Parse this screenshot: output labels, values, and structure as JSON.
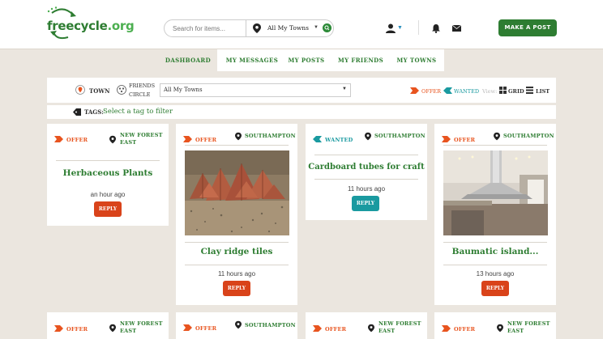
{
  "header": {
    "logo_text": "freecycle",
    "logo_suffix": ".org",
    "search_placeholder": "Search for items...",
    "town_select": "All My Towns",
    "make_post": "MAKE A POST"
  },
  "nav": {
    "tabs": [
      {
        "label": "DASHBOARD",
        "active": true
      },
      {
        "label": "MY MESSAGES",
        "active": false
      },
      {
        "label": "MY POSTS",
        "active": false
      },
      {
        "label": "MY FRIENDS",
        "active": false
      },
      {
        "label": "MY TOWNS",
        "active": false
      }
    ]
  },
  "filters": {
    "town_label": "TOWN",
    "circle_label_1": "FRIENDS",
    "circle_label_2": "CIRCLE",
    "town_dropdown": "All My Towns",
    "offer_label": "OFFER",
    "wanted_label": "WANTED",
    "view_label": "View:",
    "grid_label": "GRID",
    "list_label": "LIST",
    "tags_label": "TAGS:",
    "tags_placeholder": "Select a tag to filter"
  },
  "colors": {
    "brand_green": "#2e7d32",
    "offer_orange": "#e8541f",
    "wanted_teal": "#1a9aa0",
    "reply_red": "#d9431a"
  },
  "cards": [
    {
      "type": "OFFER",
      "location_1": "NEW FOREST",
      "location_2": "EAST",
      "title": "Herbaceous Plants",
      "time": "an hour ago",
      "reply": "REPLY"
    },
    {
      "type": "OFFER",
      "location_1": "SOUTHAMPTON",
      "location_2": "",
      "title": "Clay ridge tiles",
      "time": "11 hours ago",
      "reply": "REPLY"
    },
    {
      "type": "WANTED",
      "location_1": "SOUTHAMPTON",
      "location_2": "",
      "title": "Cardboard tubes for craft",
      "time": "11 hours ago",
      "reply": "REPLY"
    },
    {
      "type": "OFFER",
      "location_1": "SOUTHAMPTON",
      "location_2": "",
      "title": "Baumatic island...",
      "time": "13 hours ago",
      "reply": "REPLY"
    },
    {
      "type": "OFFER",
      "location_1": "NEW FOREST",
      "location_2": "EAST",
      "title": "",
      "time": "",
      "reply": ""
    },
    {
      "type": "OFFER",
      "location_1": "SOUTHAMPTON",
      "location_2": "",
      "title": "",
      "time": "",
      "reply": ""
    },
    {
      "type": "OFFER",
      "location_1": "NEW FOREST",
      "location_2": "EAST",
      "title": "",
      "time": "",
      "reply": ""
    },
    {
      "type": "OFFER",
      "location_1": "NEW FOREST",
      "location_2": "EAST",
      "title": "",
      "time": "",
      "reply": ""
    }
  ]
}
